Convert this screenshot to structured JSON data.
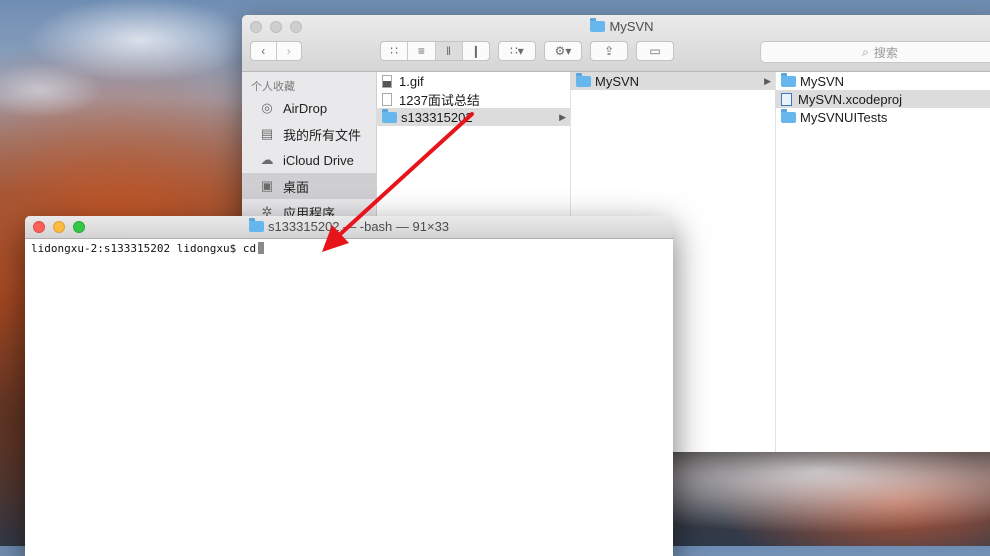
{
  "finder": {
    "title": "MySVN",
    "search_placeholder": "搜索",
    "sidebar": {
      "heading": "个人收藏",
      "items": [
        {
          "label": "AirDrop",
          "icon": "airdrop-icon",
          "selected": false
        },
        {
          "label": "我的所有文件",
          "icon": "all-files-icon",
          "selected": false
        },
        {
          "label": "iCloud Drive",
          "icon": "cloud-icon",
          "selected": false
        },
        {
          "label": "桌面",
          "icon": "desktop-icon",
          "selected": true
        },
        {
          "label": "应用程序",
          "icon": "applications-icon",
          "selected": false
        }
      ]
    },
    "columns": [
      [
        {
          "label": "1.gif",
          "type": "image"
        },
        {
          "label": "1237面试总结",
          "type": "document"
        },
        {
          "label": "s133315202",
          "type": "folder",
          "selected": true
        }
      ],
      [
        {
          "label": "MySVN",
          "type": "folder",
          "selected": true
        }
      ],
      [
        {
          "label": "MySVN",
          "type": "folder"
        },
        {
          "label": "MySVN.xcodeproj",
          "type": "xcodeproj",
          "selected": true
        },
        {
          "label": "MySVNUITests",
          "type": "folder"
        }
      ]
    ]
  },
  "terminal": {
    "title_folder": "s133315202",
    "title_rest": "— -bash — 91×33",
    "prompt": "lidongxu-2:s133315202 lidongxu$ cd"
  },
  "colors": {
    "annotation_arrow": "#e8141b",
    "folder": "#68b6ee"
  }
}
